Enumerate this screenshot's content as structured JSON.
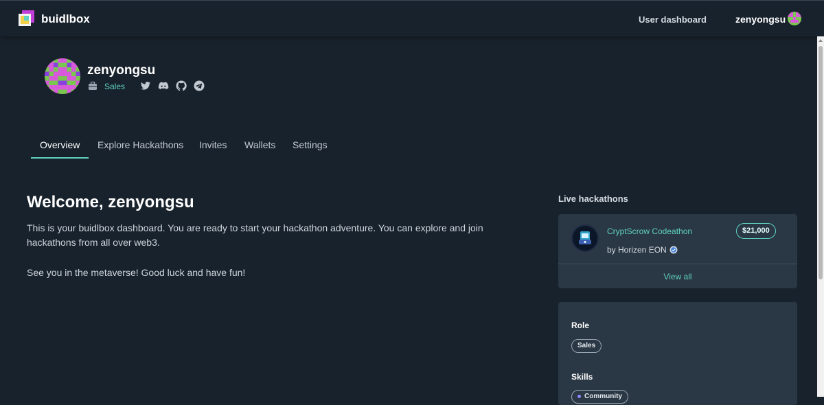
{
  "header": {
    "brand": "buidlbox",
    "nav_dashboard": "User dashboard",
    "username": "zenyongsu"
  },
  "profile": {
    "name": "zenyongsu",
    "role": "Sales",
    "social_icons": [
      "twitter-icon",
      "discord-icon",
      "github-icon",
      "telegram-icon"
    ]
  },
  "tabs": [
    {
      "label": "Overview",
      "active": true
    },
    {
      "label": "Explore Hackathons",
      "active": false
    },
    {
      "label": "Invites",
      "active": false
    },
    {
      "label": "Wallets",
      "active": false
    },
    {
      "label": "Settings",
      "active": false
    }
  ],
  "main": {
    "welcome_title": "Welcome, zenyongsu",
    "intro": "This is your buidlbox dashboard. You are ready to start your hackathon adventure. You can explore and join hackathons from all over web3.",
    "closing": "See you in the metaverse! Good luck and have fun!"
  },
  "live_hackathons": {
    "title": "Live hackathons",
    "items": [
      {
        "name": "CryptScrow Codeathon",
        "prize": "$21,000",
        "organizer": "by Horizen EON"
      }
    ],
    "view_all": "View all"
  },
  "sidebar_info": {
    "role_title": "Role",
    "role_value": "Sales",
    "skills_title": "Skills",
    "skills": [
      "Community"
    ]
  },
  "colors": {
    "background": "#18222c",
    "card": "#2a3744",
    "accent": "#5fd3c2"
  }
}
